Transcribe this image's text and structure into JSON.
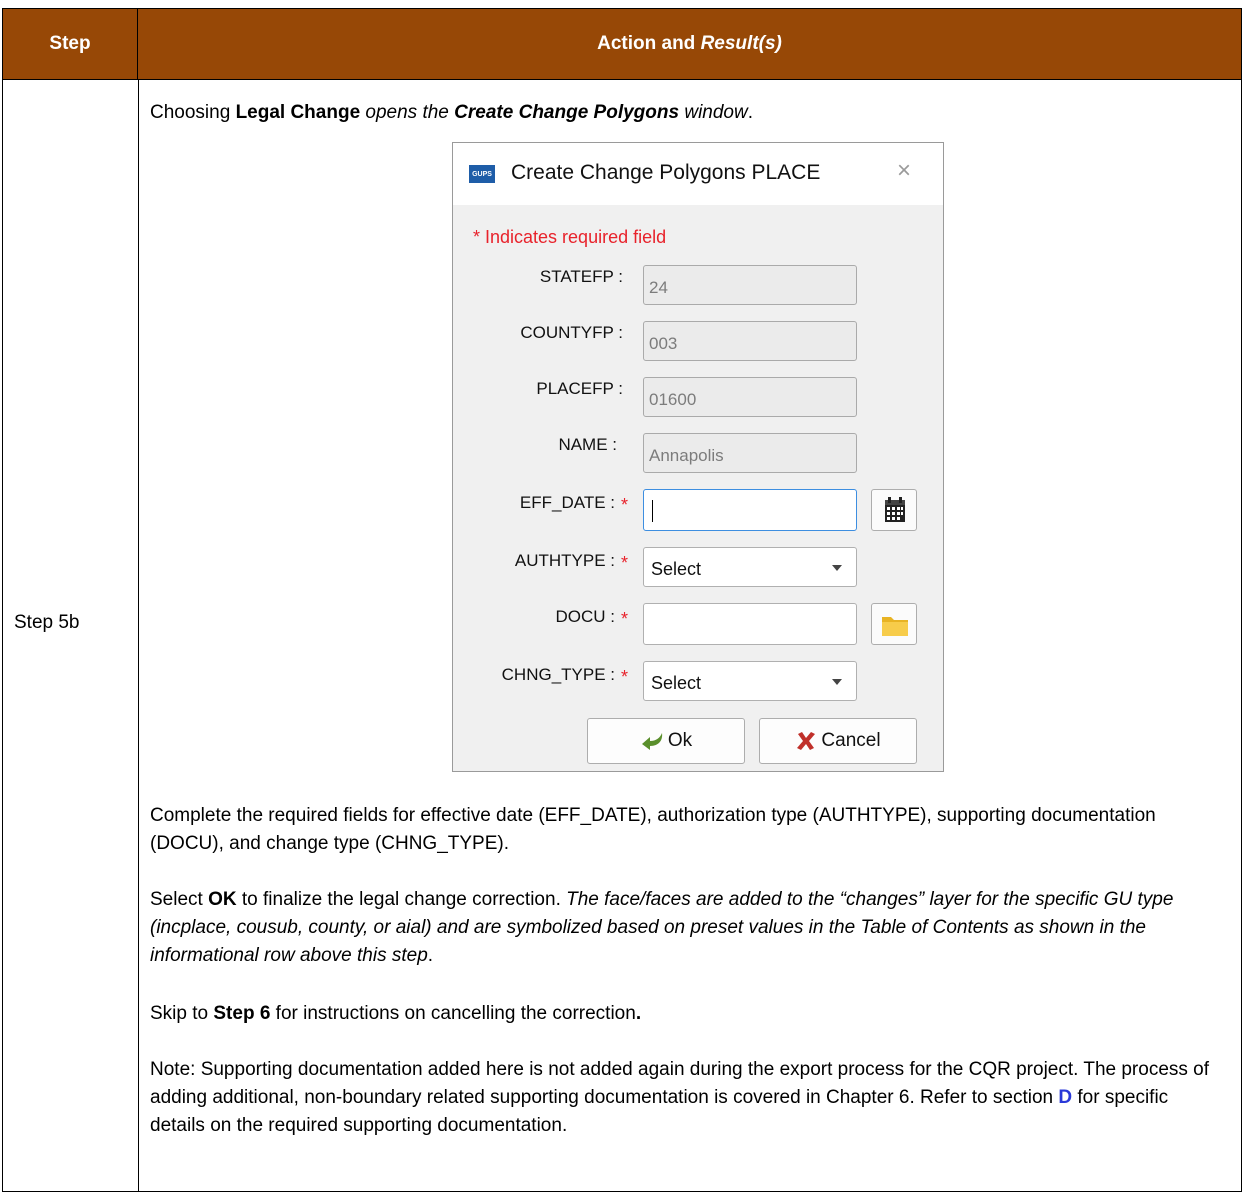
{
  "header": {
    "step": "Step",
    "action": "Action and ",
    "result": "Result(s)"
  },
  "step_label": "Step 5b",
  "intro": {
    "p1": "Choosing ",
    "b1": "Legal Change",
    "i1": " opens the ",
    "bi1": "Create Change Polygons",
    "i2": " window",
    "p2": "."
  },
  "dialog": {
    "title": "Create Change Polygons PLACE",
    "logo_text": "GUPS",
    "close_glyph": "×",
    "required_note": "* Indicates required field",
    "statefp": {
      "label": "STATEFP :",
      "value": "24"
    },
    "countyfp": {
      "label": "COUNTYFP :",
      "value": "003"
    },
    "placefp": {
      "label": "PLACEFP :",
      "value": "01600"
    },
    "name": {
      "label": "NAME :",
      "value": "Annapolis"
    },
    "eff_date": {
      "label": "EFF_DATE :",
      "value": ""
    },
    "authtype": {
      "label": "AUTHTYPE :",
      "value": "Select"
    },
    "docu": {
      "label": "DOCU :",
      "value": ""
    },
    "chng_type": {
      "label": "CHNG_TYPE :",
      "value": "Select"
    },
    "star": "*",
    "ok_label": "Ok",
    "cancel_label": "Cancel"
  },
  "para1": "Complete the required fields for effective date (EFF_DATE), authorization type (AUTHTYPE), supporting documentation (DOCU), and change type (CHNG_TYPE).",
  "para2": {
    "pre": "Select ",
    "bold": "OK",
    "mid": " to finalize the legal change correction. ",
    "italic": "The face/faces are added to the “changes” layer for the specific GU type (incplace, cousub, county, or aial) and are symbolized based on preset values in the Table of Contents as shown in the informational row above this step",
    "end": "."
  },
  "para3": {
    "pre": "Skip to ",
    "bold": "Step 6",
    "mid": " for instructions on cancelling the correction",
    "end": "."
  },
  "para4": {
    "pre": "Note: Supporting documentation added here is not added again during the export process for the CQR project. The process of adding additional, non-boundary related supporting documentation is covered in Chapter 6. Refer to section ",
    "link": "D",
    "end": " for specific details on the required supporting documentation."
  }
}
